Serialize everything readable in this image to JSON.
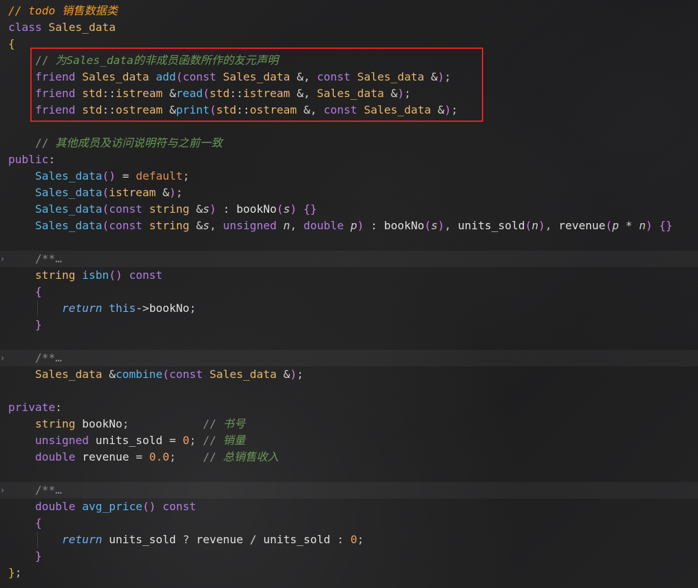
{
  "editor": {
    "folded_marker": "/**…",
    "lines": [
      [
        {
          "t": "// todo 销售数据类",
          "c": "c-cmt"
        }
      ],
      [
        {
          "t": "class ",
          "c": "c-kw"
        },
        {
          "t": "Sales_data",
          "c": "c-ty"
        }
      ],
      [
        {
          "t": "{",
          "c": "c-br"
        }
      ],
      [
        {
          "t": "    "
        },
        {
          "t": "// ",
          "c": "c-cmtg"
        },
        {
          "t": "为Sales_data的非成员函数所作的友元声明",
          "c": "c-cmt2"
        }
      ],
      [
        {
          "t": "    "
        },
        {
          "t": "friend ",
          "c": "c-kw"
        },
        {
          "t": "Sales_data ",
          "c": "c-ty"
        },
        {
          "t": "add",
          "c": "c-fn"
        },
        {
          "t": "(",
          "c": "c-br2"
        },
        {
          "t": "const ",
          "c": "c-kw"
        },
        {
          "t": "Sales_data ",
          "c": "c-ty"
        },
        {
          "t": "&, ",
          "c": "c-op"
        },
        {
          "t": "const ",
          "c": "c-kw"
        },
        {
          "t": "Sales_data ",
          "c": "c-ty"
        },
        {
          "t": "&",
          "c": "c-op"
        },
        {
          "t": ")",
          "c": "c-br2"
        },
        {
          "t": ";",
          "c": "c-pu"
        }
      ],
      [
        {
          "t": "    "
        },
        {
          "t": "friend ",
          "c": "c-kw"
        },
        {
          "t": "std",
          "c": "c-ty"
        },
        {
          "t": "::",
          "c": "c-op"
        },
        {
          "t": "istream ",
          "c": "c-ty"
        },
        {
          "t": "&",
          "c": "c-op"
        },
        {
          "t": "read",
          "c": "c-fn"
        },
        {
          "t": "(",
          "c": "c-br2"
        },
        {
          "t": "std",
          "c": "c-ty"
        },
        {
          "t": "::",
          "c": "c-op"
        },
        {
          "t": "istream ",
          "c": "c-ty"
        },
        {
          "t": "&, ",
          "c": "c-op"
        },
        {
          "t": "Sales_data ",
          "c": "c-ty"
        },
        {
          "t": "&",
          "c": "c-op"
        },
        {
          "t": ")",
          "c": "c-br2"
        },
        {
          "t": ";",
          "c": "c-pu"
        }
      ],
      [
        {
          "t": "    "
        },
        {
          "t": "friend ",
          "c": "c-kw"
        },
        {
          "t": "std",
          "c": "c-ty"
        },
        {
          "t": "::",
          "c": "c-op"
        },
        {
          "t": "ostream ",
          "c": "c-ty"
        },
        {
          "t": "&",
          "c": "c-op"
        },
        {
          "t": "print",
          "c": "c-fn"
        },
        {
          "t": "(",
          "c": "c-br2"
        },
        {
          "t": "std",
          "c": "c-ty"
        },
        {
          "t": "::",
          "c": "c-op"
        },
        {
          "t": "ostream ",
          "c": "c-ty"
        },
        {
          "t": "&, ",
          "c": "c-op"
        },
        {
          "t": "const ",
          "c": "c-kw"
        },
        {
          "t": "Sales_data ",
          "c": "c-ty"
        },
        {
          "t": "&",
          "c": "c-op"
        },
        {
          "t": ")",
          "c": "c-br2"
        },
        {
          "t": ";",
          "c": "c-pu"
        }
      ],
      [],
      [
        {
          "t": "    "
        },
        {
          "t": "// ",
          "c": "c-cmtg"
        },
        {
          "t": "其他成员及访问说明符与之前一致",
          "c": "c-cmt2"
        }
      ],
      [
        {
          "t": "public",
          "c": "c-kw"
        },
        {
          "t": ":",
          "c": "c-pu"
        }
      ],
      [
        {
          "t": "    "
        },
        {
          "t": "Sales_data",
          "c": "c-fn"
        },
        {
          "t": "()",
          "c": "c-br2"
        },
        {
          "t": " = ",
          "c": "c-op"
        },
        {
          "t": "default",
          "c": "c-def"
        },
        {
          "t": ";",
          "c": "c-pu"
        }
      ],
      [
        {
          "t": "    "
        },
        {
          "t": "Sales_data",
          "c": "c-fn"
        },
        {
          "t": "(",
          "c": "c-br2"
        },
        {
          "t": "istream ",
          "c": "c-ty"
        },
        {
          "t": "&",
          "c": "c-op"
        },
        {
          "t": ")",
          "c": "c-br2"
        },
        {
          "t": ";",
          "c": "c-pu"
        }
      ],
      [
        {
          "t": "    "
        },
        {
          "t": "Sales_data",
          "c": "c-fn"
        },
        {
          "t": "(",
          "c": "c-br2"
        },
        {
          "t": "const ",
          "c": "c-kw"
        },
        {
          "t": "string ",
          "c": "c-ty"
        },
        {
          "t": "&",
          "c": "c-op"
        },
        {
          "t": "s",
          "c": "c-it"
        },
        {
          "t": ")",
          "c": "c-br2"
        },
        {
          "t": " : ",
          "c": "c-op"
        },
        {
          "t": "bookNo",
          "c": "c-var"
        },
        {
          "t": "(",
          "c": "c-br2"
        },
        {
          "t": "s",
          "c": "c-it"
        },
        {
          "t": ")",
          "c": "c-br2"
        },
        {
          "t": " {}",
          "c": "c-br2"
        }
      ],
      [
        {
          "t": "    "
        },
        {
          "t": "Sales_data",
          "c": "c-fn"
        },
        {
          "t": "(",
          "c": "c-br2"
        },
        {
          "t": "const ",
          "c": "c-kw"
        },
        {
          "t": "string ",
          "c": "c-ty"
        },
        {
          "t": "&",
          "c": "c-op"
        },
        {
          "t": "s",
          "c": "c-it"
        },
        {
          "t": ", ",
          "c": "c-pu"
        },
        {
          "t": "unsigned ",
          "c": "c-kw"
        },
        {
          "t": "n",
          "c": "c-it"
        },
        {
          "t": ", ",
          "c": "c-pu"
        },
        {
          "t": "double ",
          "c": "c-kw"
        },
        {
          "t": "p",
          "c": "c-it"
        },
        {
          "t": ")",
          "c": "c-br2"
        },
        {
          "t": " : ",
          "c": "c-op"
        },
        {
          "t": "bookNo",
          "c": "c-var"
        },
        {
          "t": "(",
          "c": "c-br2"
        },
        {
          "t": "s",
          "c": "c-it"
        },
        {
          "t": ")",
          "c": "c-br2"
        },
        {
          "t": ", ",
          "c": "c-pu"
        },
        {
          "t": "units_sold",
          "c": "c-var"
        },
        {
          "t": "(",
          "c": "c-br2"
        },
        {
          "t": "n",
          "c": "c-it"
        },
        {
          "t": ")",
          "c": "c-br2"
        },
        {
          "t": ", ",
          "c": "c-pu"
        },
        {
          "t": "revenue",
          "c": "c-var"
        },
        {
          "t": "(",
          "c": "c-br2"
        },
        {
          "t": "p",
          "c": "c-it"
        },
        {
          "t": " * ",
          "c": "c-op"
        },
        {
          "t": "n",
          "c": "c-it"
        },
        {
          "t": ")",
          "c": "c-br2"
        },
        {
          "t": " {}",
          "c": "c-br2"
        }
      ],
      [],
      [
        {
          "t": "    "
        },
        {
          "t": "/**…",
          "c": "c-cmtg"
        }
      ],
      [
        {
          "t": "    "
        },
        {
          "t": "string ",
          "c": "c-ty"
        },
        {
          "t": "isbn",
          "c": "c-fn"
        },
        {
          "t": "()",
          "c": "c-br2"
        },
        {
          "t": " const",
          "c": "c-kw"
        }
      ],
      [
        {
          "t": "    "
        },
        {
          "t": "{",
          "c": "c-br2"
        }
      ],
      [
        {
          "t": "        "
        },
        {
          "t": "return ",
          "c": "c-ret"
        },
        {
          "t": "this",
          "c": "c-this"
        },
        {
          "t": "->",
          "c": "c-op"
        },
        {
          "t": "bookNo",
          "c": "c-var"
        },
        {
          "t": ";",
          "c": "c-pu"
        }
      ],
      [
        {
          "t": "    "
        },
        {
          "t": "}",
          "c": "c-br2"
        }
      ],
      [],
      [
        {
          "t": "    "
        },
        {
          "t": "/**…",
          "c": "c-cmtg"
        }
      ],
      [
        {
          "t": "    "
        },
        {
          "t": "Sales_data ",
          "c": "c-ty"
        },
        {
          "t": "&",
          "c": "c-op"
        },
        {
          "t": "combine",
          "c": "c-fn"
        },
        {
          "t": "(",
          "c": "c-br2"
        },
        {
          "t": "const ",
          "c": "c-kw"
        },
        {
          "t": "Sales_data ",
          "c": "c-ty"
        },
        {
          "t": "&",
          "c": "c-op"
        },
        {
          "t": ")",
          "c": "c-br2"
        },
        {
          "t": ";",
          "c": "c-pu"
        }
      ],
      [],
      [
        {
          "t": "private",
          "c": "c-kw"
        },
        {
          "t": ":",
          "c": "c-pu"
        }
      ],
      [
        {
          "t": "    "
        },
        {
          "t": "string ",
          "c": "c-ty"
        },
        {
          "t": "bookNo",
          "c": "c-var"
        },
        {
          "t": ";",
          "c": "c-pu"
        },
        {
          "t": "           "
        },
        {
          "t": "// ",
          "c": "c-cmtg"
        },
        {
          "t": "书号",
          "c": "c-cmt2"
        }
      ],
      [
        {
          "t": "    "
        },
        {
          "t": "unsigned ",
          "c": "c-kw"
        },
        {
          "t": "units_sold",
          "c": "c-var"
        },
        {
          "t": " = ",
          "c": "c-op"
        },
        {
          "t": "0",
          "c": "c-num"
        },
        {
          "t": "; ",
          "c": "c-pu"
        },
        {
          "t": "// ",
          "c": "c-cmtg"
        },
        {
          "t": "销量",
          "c": "c-cmt2"
        }
      ],
      [
        {
          "t": "    "
        },
        {
          "t": "double ",
          "c": "c-kw"
        },
        {
          "t": "revenue",
          "c": "c-var"
        },
        {
          "t": " = ",
          "c": "c-op"
        },
        {
          "t": "0.0",
          "c": "c-num"
        },
        {
          "t": ";",
          "c": "c-pu"
        },
        {
          "t": "    "
        },
        {
          "t": "// ",
          "c": "c-cmtg"
        },
        {
          "t": "总销售收入",
          "c": "c-cmt2"
        }
      ],
      [],
      [
        {
          "t": "    "
        },
        {
          "t": "/**…",
          "c": "c-cmtg"
        }
      ],
      [
        {
          "t": "    "
        },
        {
          "t": "double ",
          "c": "c-kw"
        },
        {
          "t": "avg_price",
          "c": "c-fn"
        },
        {
          "t": "()",
          "c": "c-br2"
        },
        {
          "t": " const",
          "c": "c-kw"
        }
      ],
      [
        {
          "t": "    "
        },
        {
          "t": "{",
          "c": "c-br2"
        }
      ],
      [
        {
          "t": "        "
        },
        {
          "t": "return ",
          "c": "c-ret"
        },
        {
          "t": "units_sold",
          "c": "c-var"
        },
        {
          "t": " ? ",
          "c": "c-op"
        },
        {
          "t": "revenue",
          "c": "c-var"
        },
        {
          "t": " / ",
          "c": "c-op"
        },
        {
          "t": "units_sold",
          "c": "c-var"
        },
        {
          "t": " : ",
          "c": "c-op"
        },
        {
          "t": "0",
          "c": "c-num"
        },
        {
          "t": ";",
          "c": "c-pu"
        }
      ],
      [
        {
          "t": "    "
        },
        {
          "t": "}",
          "c": "c-br2"
        }
      ],
      [
        {
          "t": "}",
          "c": "c-br"
        },
        {
          "t": ";",
          "c": "c-pu"
        }
      ]
    ],
    "folded_lines": [
      15,
      21,
      29
    ],
    "highlight_box": {
      "start": 3,
      "end": 6,
      "color": "#e02424"
    },
    "fold_glyph": "›"
  }
}
